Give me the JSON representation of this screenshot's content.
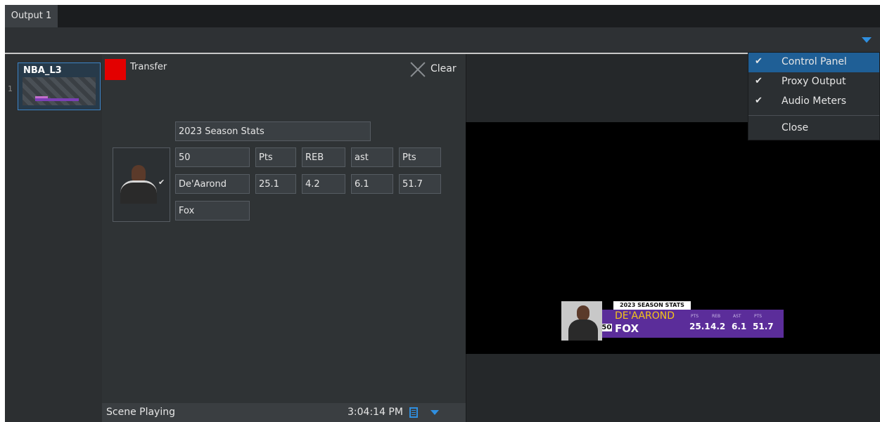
{
  "window": {
    "tab_label": "Output 1"
  },
  "scenes": {
    "row_number": "1",
    "items": [
      {
        "name": "NBA_L3"
      }
    ]
  },
  "control_panel": {
    "transfer_label": "Transfer",
    "transfer_color": "#e30000",
    "clear_label": "Clear",
    "title_value": "2023 Season Stats",
    "row1": [
      "50",
      "Pts",
      "REB",
      "ast",
      "Pts"
    ],
    "row2": [
      "De'Aarond",
      "25.1",
      "4.2",
      "6.1",
      "51.7"
    ],
    "row3": [
      "Fox"
    ]
  },
  "status": {
    "text": "Scene Playing",
    "time": "3:04:14 PM",
    "accent_color": "#2f8fe0"
  },
  "preview": {
    "title": "2023 SEASON STATS",
    "first_name": "DE'AAROND",
    "last_name": "FOX",
    "number": "#50",
    "stat_heads": [
      "PTS",
      "REB",
      "AST",
      "PTS"
    ],
    "stat_values": [
      "25.1",
      "4.2",
      "6.1",
      "51.7"
    ]
  },
  "view_menu": {
    "items": [
      {
        "label": "Control Panel",
        "checked": true,
        "check": "✔"
      },
      {
        "label": "Proxy Output",
        "checked": true,
        "check": "✔"
      },
      {
        "label": "Audio Meters",
        "checked": true,
        "check": "✔"
      }
    ],
    "close_label": "Close"
  }
}
